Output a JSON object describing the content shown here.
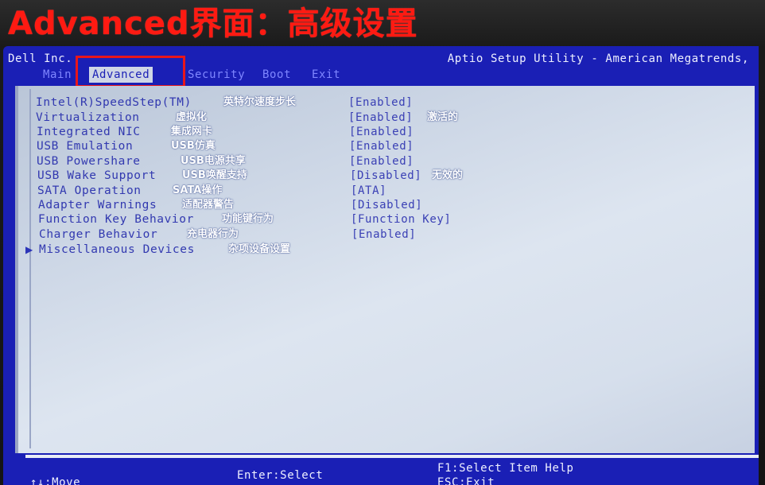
{
  "caption": "Advanced界面：高级设置",
  "header": {
    "vendor": "Dell Inc.",
    "utility_title": "Aptio Setup Utility - American Megatrends,"
  },
  "tabs": [
    {
      "label": "Main",
      "active": false
    },
    {
      "label": "Advanced",
      "active": true
    },
    {
      "label": "Security",
      "active": false
    },
    {
      "label": "Boot",
      "active": false
    },
    {
      "label": "Exit",
      "active": false
    }
  ],
  "settings": [
    {
      "label": "Intel(R)SpeedStep(TM)",
      "note": "英特尔速度步长",
      "value": "[Enabled]",
      "value_note": ""
    },
    {
      "label": "Virtualization",
      "note": "虚拟化",
      "value": "[Enabled]",
      "value_note": "激活的"
    },
    {
      "label": "Integrated NIC",
      "note": "集成网卡",
      "value": "[Enabled]",
      "value_note": ""
    },
    {
      "label": "USB Emulation",
      "note": "USB仿真",
      "value": "[Enabled]",
      "value_note": ""
    },
    {
      "label": "USB Powershare",
      "note": "USB电源共享",
      "value": "[Enabled]",
      "value_note": ""
    },
    {
      "label": "USB Wake Support",
      "note": "USB唤醒支持",
      "value": "[Disabled]",
      "value_note": "无效的"
    },
    {
      "label": "SATA Operation",
      "note": "SATA操作",
      "value": "[ATA]",
      "value_note": ""
    },
    {
      "label": "Adapter Warnings",
      "note": "适配器警告",
      "value": "[Disabled]",
      "value_note": ""
    },
    {
      "label": "Function Key Behavior",
      "note": "功能键行为",
      "value": "[Function Key]",
      "value_note": ""
    },
    {
      "label": "Charger Behavior",
      "note": "充电器行为",
      "value": "[Enabled]",
      "value_note": ""
    }
  ],
  "submenu": {
    "arrow": "▶",
    "label": "Miscellaneous Devices",
    "note": "杂项设备设置"
  },
  "help": {
    "move": "↑↓:Move",
    "select": "Enter:Select",
    "item_help": "F1:Select Item Help",
    "exit": "ESC:Exit"
  },
  "colors": {
    "screen_blue": "#1a1fb5",
    "panel_light": "#d6dfec",
    "caption_red": "#ff1a12",
    "highlight_red": "#e8161b"
  }
}
